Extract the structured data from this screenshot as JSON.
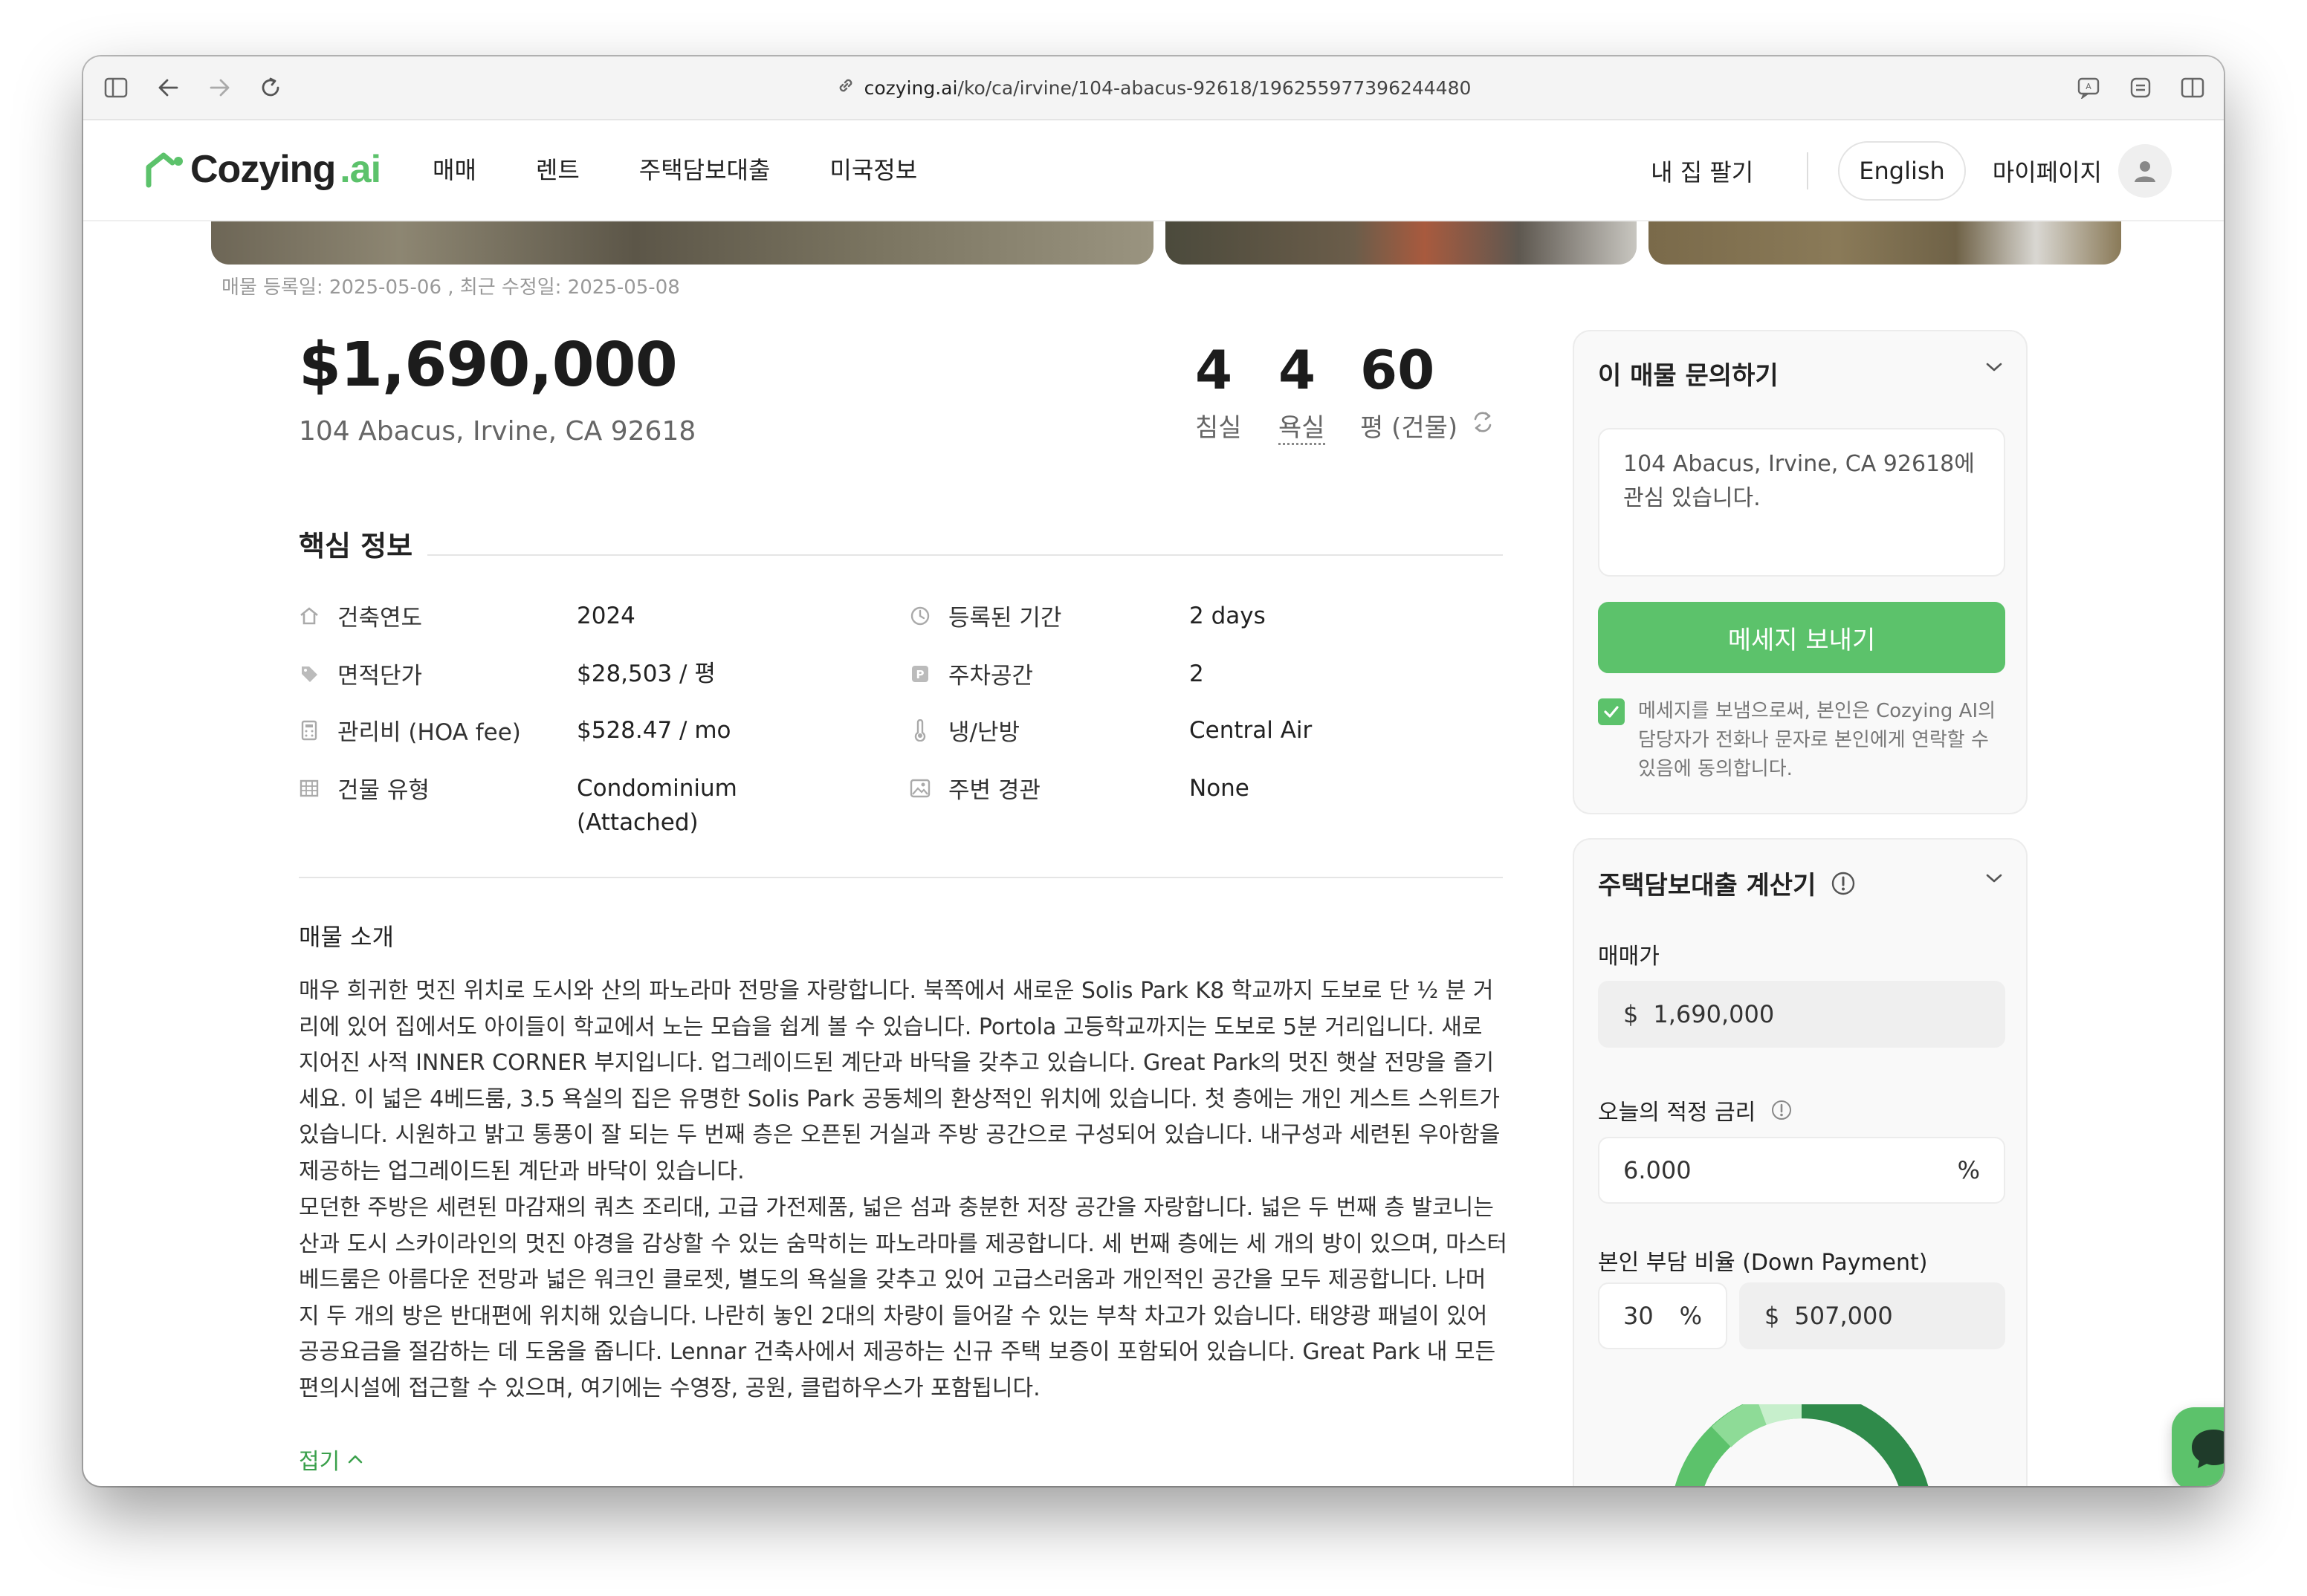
{
  "browser": {
    "url_domain": "cozying.ai",
    "url_path": "/ko/ca/irvine/104-abacus-92618/196255977396244480"
  },
  "header": {
    "logo_main": "Cozying",
    "logo_suffix": ".ai",
    "nav": [
      "매매",
      "렌트",
      "주택담보대출",
      "미국정보"
    ],
    "sell_label": "내 집 팔기",
    "language_label": "English",
    "mypage_label": "마이페이지"
  },
  "listing": {
    "dates": "매물 등록일:  2025-05-06 , 최근 수정일:  2025-05-08",
    "price": "$1,690,000",
    "address": "104 Abacus, Irvine, CA 92618",
    "beds_value": "4",
    "beds_label": "침실",
    "baths_value": "4",
    "baths_label": "욕실",
    "size_value": "60",
    "size_label": "평 (건물)"
  },
  "key_info": {
    "title": "핵심 정보",
    "left": [
      {
        "icon": "building-year-icon",
        "label": "건축연도",
        "value": "2024"
      },
      {
        "icon": "tag-icon",
        "label": "면적단가",
        "value": "$28,503 / 평"
      },
      {
        "icon": "calculator-icon",
        "label": "관리비 (HOA fee)",
        "value": "$528.47 / mo"
      },
      {
        "icon": "building-type-icon",
        "label": "건물 유형",
        "value": "Condominium\n(Attached)"
      }
    ],
    "right": [
      {
        "icon": "clock-icon",
        "label": "등록된 기간",
        "value": "2 days"
      },
      {
        "icon": "parking-icon",
        "label": "주차공간",
        "value": "2"
      },
      {
        "icon": "thermometer-icon",
        "label": "냉/난방",
        "value": "Central Air"
      },
      {
        "icon": "view-icon",
        "label": "주변 경관",
        "value": "None"
      }
    ]
  },
  "description": {
    "title": "매물 소개",
    "paragraph1_lines": [
      "매우 희귀한 멋진 위치로 도시와 산의 파노라마 전망을 자랑합니다. 북쪽에서 새로운 Solis Park K8 학교까지 도보로 단 ½ 분 거",
      "리에 있어 집에서도 아이들이 학교에서 노는 모습을 쉽게 볼 수 있습니다. Portola 고등학교까지는 도보로 5분 거리입니다. 새로",
      "지어진 사적 INNER CORNER 부지입니다. 업그레이드된 계단과 바닥을 갖추고 있습니다. Great Park의 멋진 햇살 전망을 즐기",
      "세요. 이 넓은 4베드룸, 3.5 욕실의 집은 유명한 Solis Park 공동체의 환상적인 위치에 있습니다. 첫 층에는 개인 게스트 스위트가",
      "있습니다. 시원하고 밝고 통풍이 잘 되는 두 번째 층은 오픈된 거실과 주방 공간으로 구성되어 있습니다. 내구성과 세련된 우아함을",
      "제공하는 업그레이드된 계단과 바닥이 있습니다."
    ],
    "paragraph2_lines": [
      "모던한 주방은 세련된 마감재의 쿼츠 조리대, 고급 가전제품, 넓은 섬과 충분한 저장 공간을 자랑합니다. 넓은 두 번째 층 발코니는",
      "산과 도시 스카이라인의 멋진 야경을 감상할 수 있는 숨막히는 파노라마를 제공합니다. 세 번째 층에는 세 개의 방이 있으며, 마스터",
      "베드룸은 아름다운 전망과 넓은 워크인 클로젯, 별도의 욕실을 갖추고 있어 고급스러움과 개인적인 공간을 모두 제공합니다. 나머",
      "지 두 개의 방은 반대편에 위치해 있습니다. 나란히 놓인 2대의 차량이 들어갈 수 있는 부착 차고가 있습니다. 태양광 패널이 있어",
      "공공요금을 절감하는 데 도움을 줍니다. Lennar 건축사에서 제공하는 신규 주택 보증이 포함되어 있습니다. Great Park 내 모든",
      "편의시설에 접근할 수 있으며, 여기에는 수영장, 공원, 클럽하우스가 포함됩니다."
    ],
    "fold_label": "접기"
  },
  "inquiry": {
    "title": "이 매물 문의하기",
    "message": "104 Abacus, Irvine, CA 92618에 관심 있습니다.",
    "send_label": "메세지 보내기",
    "consent": "메세지를 보냄으로써, 본인은 Cozying AI의 담당자가 전화나 문자로 본인에게 연락할 수 있음에 동의합니다."
  },
  "calculator": {
    "title": "주택담보대출 계산기",
    "price_label": "매매가",
    "price_prefix": "$",
    "price_value": "1,690,000",
    "rate_label": "오늘의 적정 금리",
    "rate_value": "6.000",
    "rate_unit": "%",
    "down_label": "본인 부담 비율 (Down Payment)",
    "down_percent": "30",
    "down_percent_unit": "%",
    "down_prefix": "$",
    "down_amount": "507,000"
  },
  "colors": {
    "brand_green": "#5cc26b",
    "dark_green": "#2f8a4a"
  }
}
